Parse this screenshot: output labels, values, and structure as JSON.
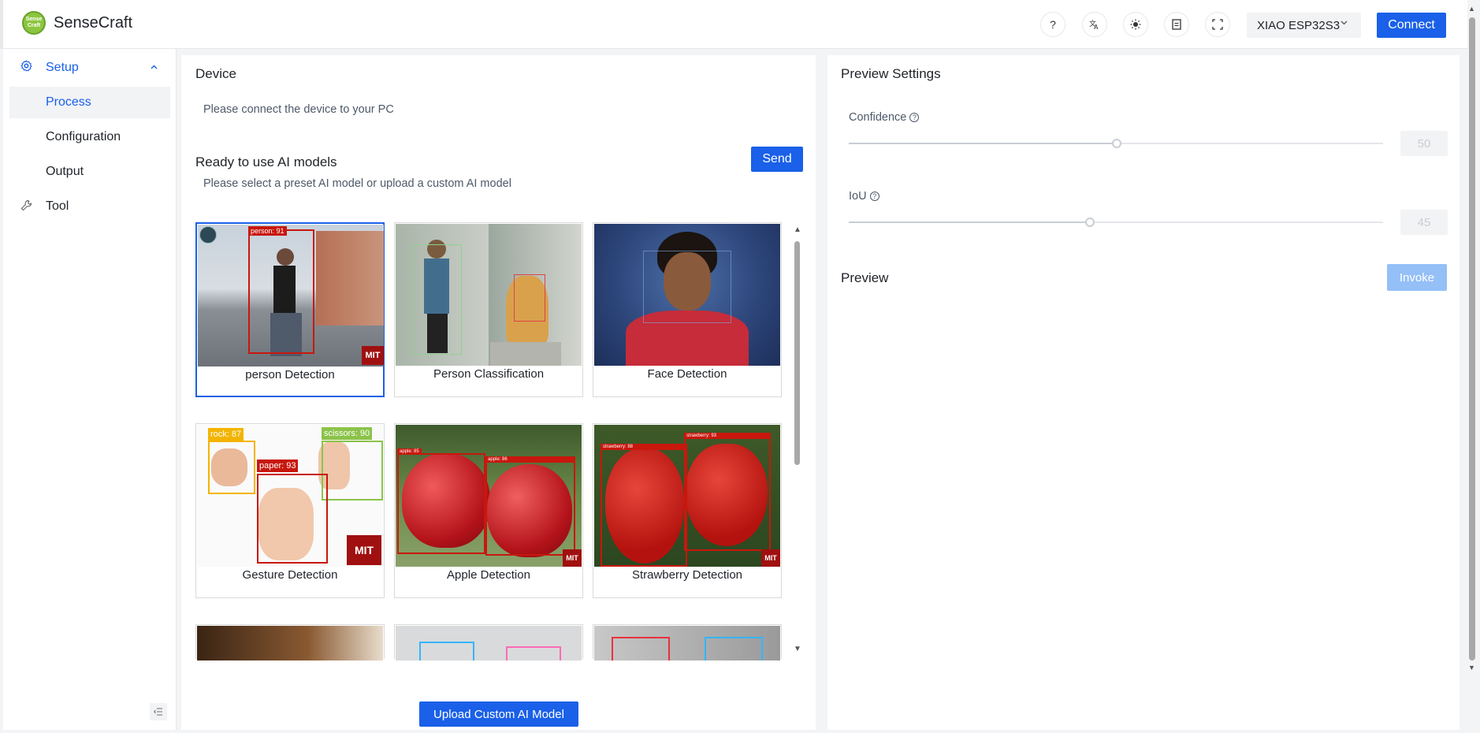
{
  "header": {
    "brand": "SenseCraft",
    "logo_text": "Sense Craft",
    "icons": [
      "help-icon",
      "translate-icon",
      "theme-icon",
      "document-icon",
      "fullscreen-icon"
    ],
    "device": "XIAO ESP32S3",
    "connect_label": "Connect"
  },
  "sidebar": {
    "setup_label": "Setup",
    "items": [
      {
        "label": "Process"
      },
      {
        "label": "Configuration"
      },
      {
        "label": "Output"
      }
    ],
    "tool_label": "Tool"
  },
  "device_panel": {
    "title": "Device",
    "hint": "Please connect the device to your PC"
  },
  "models_panel": {
    "title": "Ready to use AI models",
    "hint": "Please select a preset AI model or upload a custom AI model",
    "send_label": "Send",
    "upload_label": "Upload Custom AI Model",
    "models": [
      {
        "name": "person Detection"
      },
      {
        "name": "Person Classification"
      },
      {
        "name": "Face Detection"
      },
      {
        "name": "Gesture Detection"
      },
      {
        "name": "Apple Detection"
      },
      {
        "name": "Strawberry Detection"
      }
    ],
    "thumb_labels": {
      "person": "person: 91",
      "rock": "rock: 87",
      "scissors": "scissors: 90",
      "paper": "paper: 93",
      "apple1": "apple: 85",
      "apple2": "apple: 86",
      "straw1": "strawberry: 88",
      "straw2": "strawberry: 93",
      "license": "License"
    }
  },
  "preview_settings": {
    "title": "Preview Settings",
    "confidence_label": "Confidence",
    "confidence_value": "50",
    "iou_label": "IoU",
    "iou_value": "45"
  },
  "preview": {
    "title": "Preview",
    "invoke_label": "Invoke"
  },
  "colors": {
    "primary": "#1a60e8",
    "disabled_primary": "#94bff7",
    "bbox_red": "#c8170d"
  }
}
